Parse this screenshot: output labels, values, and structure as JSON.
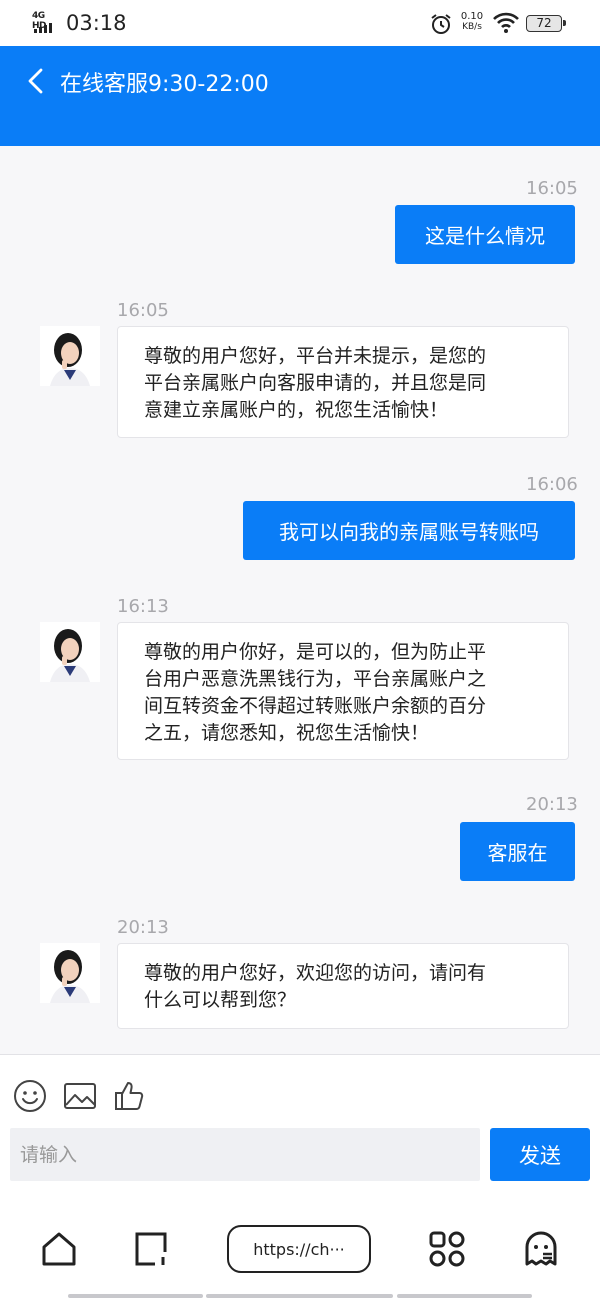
{
  "status_bar": {
    "network": "4G HD",
    "time": "03:18",
    "speed_value": "0.10",
    "speed_unit": "KB/s",
    "battery": "72"
  },
  "header": {
    "title": "在线客服9:30-22:00"
  },
  "messages": [
    {
      "side": "out",
      "time": "16:05",
      "text": "这是什么情况"
    },
    {
      "side": "in",
      "time": "16:05",
      "lines": [
        "尊敬的用户您好，平台并未提示，是您的",
        "平台亲属账户向客服申请的，并且您是同",
        "意建立亲属账户的，祝您生活愉快！"
      ]
    },
    {
      "side": "out",
      "time": "16:06",
      "text": "我可以向我的亲属账号转账吗"
    },
    {
      "side": "in",
      "time": "16:13",
      "lines": [
        "尊敬的用户你好，是可以的，但为防止平",
        "台用户恶意洗黑钱行为，平台亲属账户之",
        "间互转资金不得超过转账账户余额的百分",
        "之五，请您悉知，祝您生活愉快！"
      ]
    },
    {
      "side": "out",
      "time": "20:13",
      "text": "客服在"
    },
    {
      "side": "in",
      "time": "20:13",
      "lines": [
        "尊敬的用户您好，欢迎您的访问，请问有",
        "什么可以帮到您？"
      ]
    }
  ],
  "composer": {
    "placeholder": "请输入",
    "send_label": "发送"
  },
  "browser": {
    "url": "https://ch···"
  },
  "colors": {
    "accent": "#0a7df7",
    "timestamp": "#a8a8ac"
  }
}
